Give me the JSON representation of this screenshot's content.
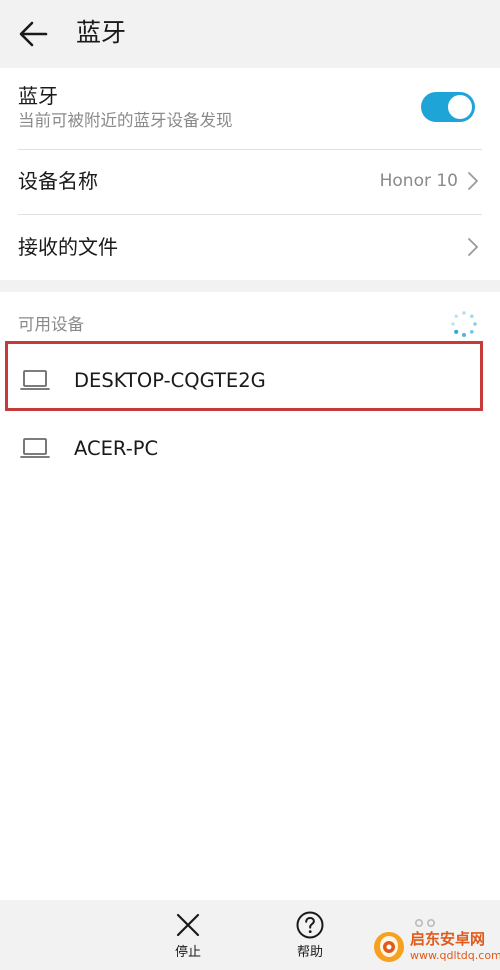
{
  "header": {
    "title": "蓝牙"
  },
  "bluetooth": {
    "title": "蓝牙",
    "subtitle": "当前可被附近的蓝牙设备发现",
    "enabled": true,
    "accent_color": "#1fa4d8"
  },
  "device_name": {
    "label": "设备名称",
    "value": "Honor 10"
  },
  "received_files": {
    "label": "接收的文件"
  },
  "available_devices": {
    "section_label": "可用设备",
    "devices": [
      {
        "name": "DESKTOP-CQGTE2G",
        "icon": "laptop-icon"
      },
      {
        "name": "ACER-PC",
        "icon": "laptop-icon"
      }
    ]
  },
  "bottom_bar": {
    "stop_label": "停止",
    "help_label": "帮助"
  },
  "watermark": {
    "title": "启东安卓网",
    "url": "www.qdltdq.com"
  },
  "highlight_color": "#c83a3a"
}
